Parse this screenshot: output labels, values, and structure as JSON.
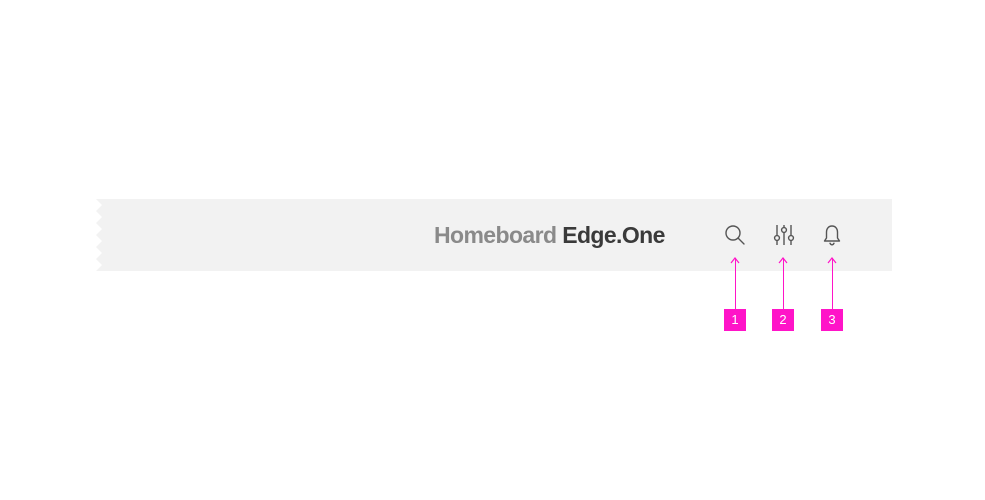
{
  "header": {
    "brand_primary": "Homeboard",
    "brand_secondary": "Edge.One"
  },
  "icons": [
    {
      "name": "search-icon",
      "callout": "1"
    },
    {
      "name": "filter-sliders-icon",
      "callout": "2"
    },
    {
      "name": "bell-icon",
      "callout": "3"
    }
  ],
  "colors": {
    "header_background": "#f2f2f2",
    "brand_primary": "#8a8a8a",
    "brand_secondary": "#3a3a3a",
    "icon_stroke": "#555555",
    "callout_accent": "#ff14c8"
  }
}
